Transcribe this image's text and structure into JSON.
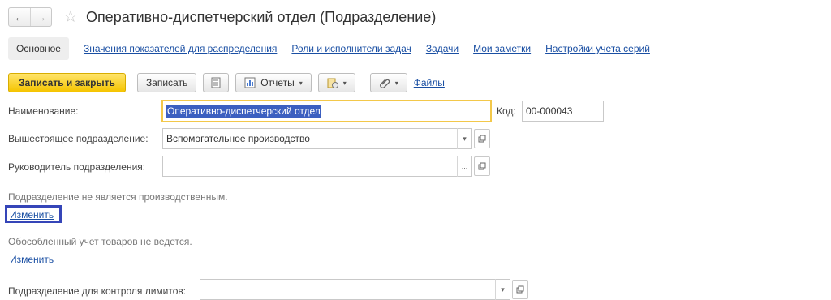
{
  "window": {
    "title": "Оперативно-диспетчерский отдел (Подразделение)",
    "back_glyph": "←",
    "forward_glyph": "→",
    "favorite_glyph": "☆"
  },
  "tabs": {
    "active": "Основное",
    "links": [
      "Значения показателей для распределения",
      "Роли и исполнители задач",
      "Задачи",
      "Мои заметки",
      "Настройки учета серий"
    ]
  },
  "toolbar": {
    "save_close": "Записать и закрыть",
    "save": "Записать",
    "reports": "Отчеты",
    "files": "Файлы",
    "caret": "▾"
  },
  "form": {
    "name_label": "Наименование:",
    "name_value": "Оперативно-диспетчерский отдел",
    "code_label": "Код:",
    "code_value": "00-000043",
    "parent_label": "Вышестоящее подразделение:",
    "parent_value": "Вспомогательное производство",
    "head_label": "Руководитель подразделения:",
    "head_value": "",
    "production_info": "Подразделение не является производственным.",
    "production_change": "Изменить",
    "separate_info": "Обособленный учет товаров не ведется.",
    "separate_change": "Изменить",
    "limits_label": "Подразделение для контроля лимитов:",
    "limits_value": "",
    "dropdown_glyph": "▾",
    "ellipsis_glyph": "..."
  },
  "colors": {
    "accent_yellow": "#f5c400",
    "link_blue": "#1a4fa3",
    "highlight_box": "#3545b8",
    "selection": "#3b5fc0"
  }
}
